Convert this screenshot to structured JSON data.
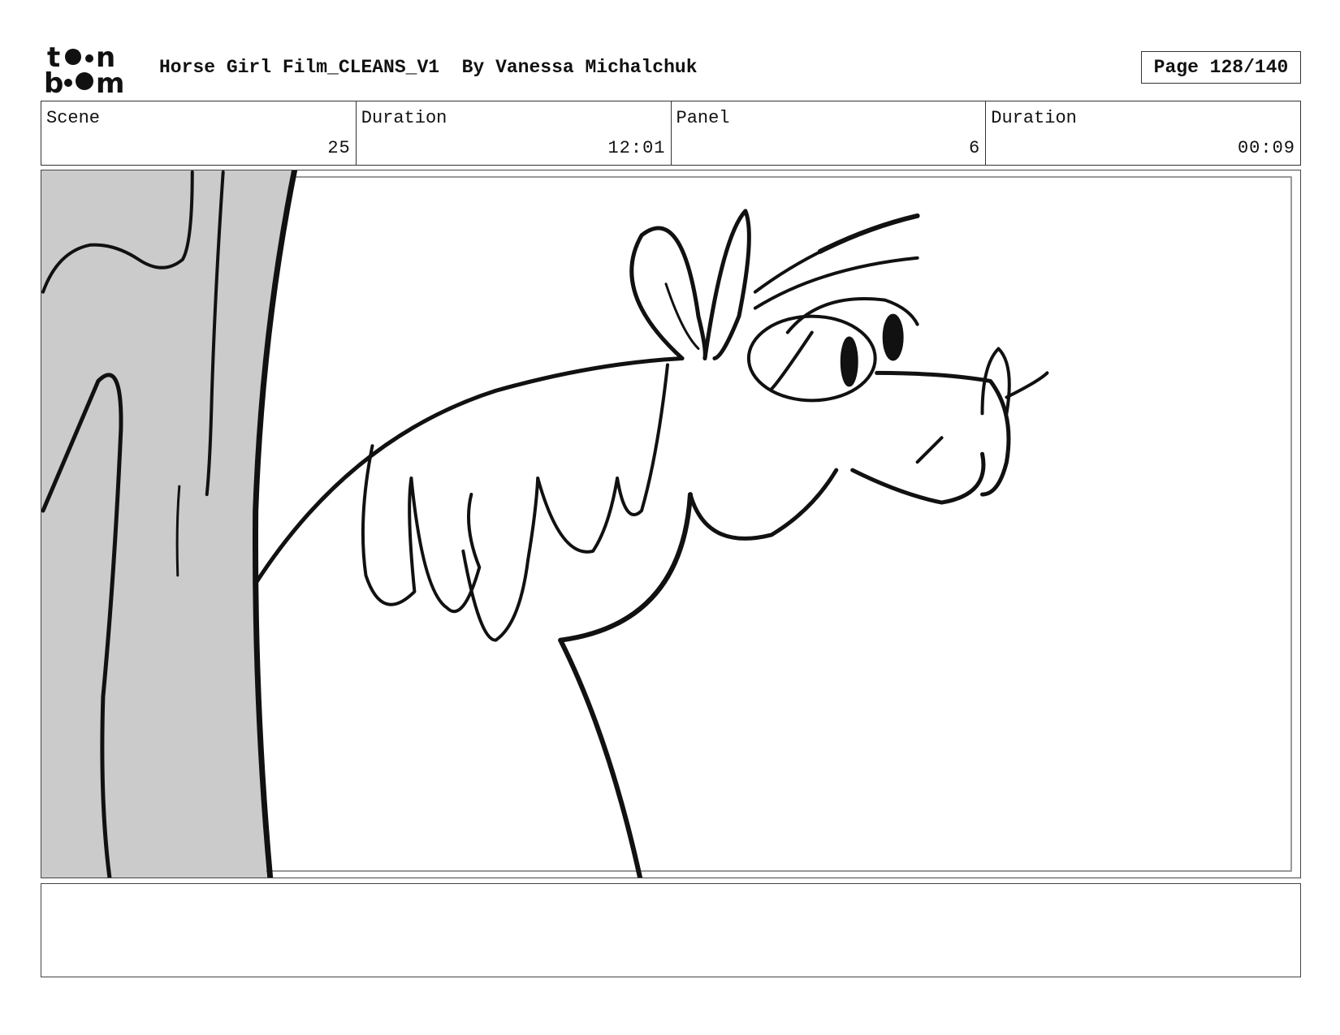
{
  "header": {
    "logo_text": "toon boom",
    "project_title": "Horse Girl Film_CLEANS_V1",
    "author": "By Vanessa Michalchuk",
    "page_label": "Page 128/140"
  },
  "info": {
    "scene_label": "Scene",
    "scene_value": "25",
    "scene_duration_label": "Duration",
    "scene_duration_value": "12:01",
    "panel_label": "Panel",
    "panel_value": "6",
    "panel_duration_label": "Duration",
    "panel_duration_value": "00:09"
  },
  "panel": {
    "image_name": "storyboard-sketch-horse-by-tree"
  },
  "notes": {
    "text": ""
  }
}
